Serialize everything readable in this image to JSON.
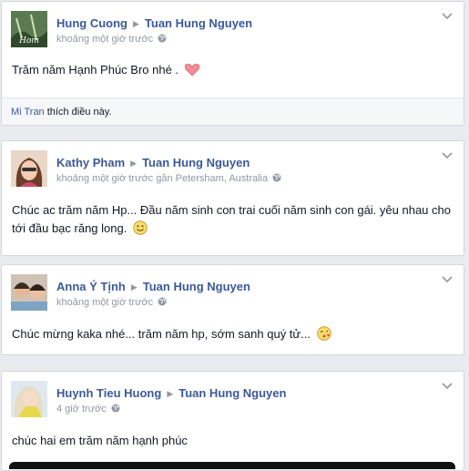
{
  "posts": [
    {
      "author": "Hung Cuong",
      "target": "Tuan Hung Nguyen",
      "meta": "khoảng một giờ trước",
      "message": "Trăm năm Hạnh Phúc Bro nhé .",
      "emoji": "heart-icon",
      "likes": {
        "name": "Mi Tran",
        "text": "thích điều này."
      },
      "avatar_text": "Hom"
    },
    {
      "author": "Kathy Pham",
      "target": "Tuan Hung Nguyen",
      "meta": "khoảng một giờ trước gần Petersham, Australia",
      "message": "Chúc ac trăm năm Hp... Đầu năm sinh con trai cuối năm sinh con gái. yêu nhau cho tới đầu bạc răng long.",
      "emoji": "smile-icon"
    },
    {
      "author": "Anna Ý Tịnh",
      "target": "Tuan Hung Nguyen",
      "meta": "khoảng một giờ trước",
      "message": "Chúc mừng kaka nhé... trăm năm hp, sớm sanh quý tử...",
      "emoji": "kiss-icon"
    },
    {
      "author": "Huynh Tieu Huong",
      "target": "Tuan Hung Nguyen",
      "meta": "4 giờ trước",
      "message": "chúc hai em trăm năm hạnh phúc"
    }
  ],
  "colors": {
    "link": "#3b5998",
    "meta": "#9197a3",
    "border": "#d3d6db",
    "background": "#e9ebee"
  }
}
